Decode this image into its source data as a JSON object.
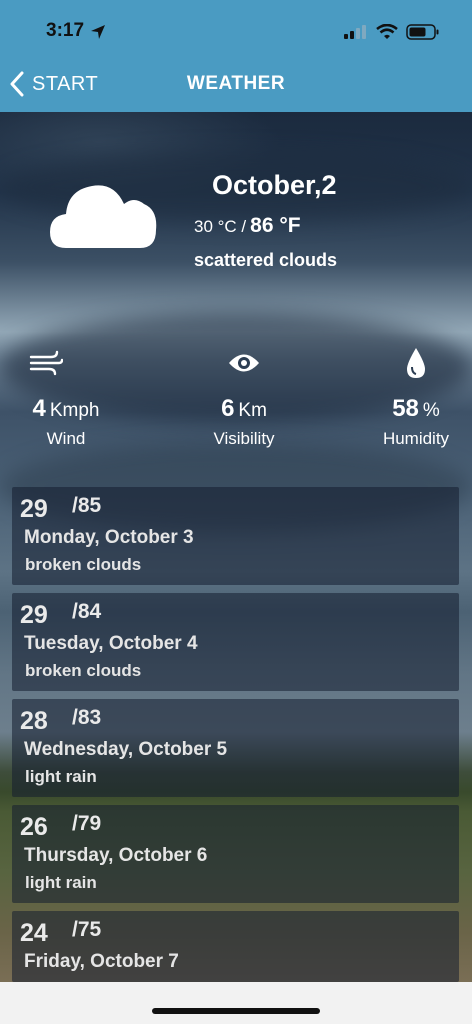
{
  "status": {
    "time": "3:17"
  },
  "nav": {
    "back_label": "START",
    "title": "WEATHER"
  },
  "current": {
    "date": "October,2",
    "temp_c": "30 °C /",
    "temp_f": "86 °F",
    "description": "scattered clouds",
    "icon": "cloud-icon"
  },
  "stats": {
    "wind": {
      "value": "4",
      "unit": "Kmph",
      "label": "Wind",
      "icon": "wind-icon"
    },
    "visibility": {
      "value": "6",
      "unit": "Km",
      "label": "Visibility",
      "icon": "eye-icon"
    },
    "humidity": {
      "value": "58",
      "unit": "%",
      "label": "Humidity",
      "icon": "droplet-icon"
    }
  },
  "forecast": [
    {
      "high": "29",
      "low": "/85",
      "day": "Monday, October 3",
      "condition": "broken clouds"
    },
    {
      "high": "29",
      "low": "/84",
      "day": "Tuesday, October 4",
      "condition": "broken clouds"
    },
    {
      "high": "28",
      "low": "/83",
      "day": "Wednesday, October 5",
      "condition": "light rain"
    },
    {
      "high": "26",
      "low": "/79",
      "day": "Thursday, October 6",
      "condition": "light rain"
    },
    {
      "high": "24",
      "low": "/75",
      "day": "Friday, October 7",
      "condition": ""
    }
  ],
  "colors": {
    "accent": "#4a9bc2",
    "card": "#141e30"
  }
}
